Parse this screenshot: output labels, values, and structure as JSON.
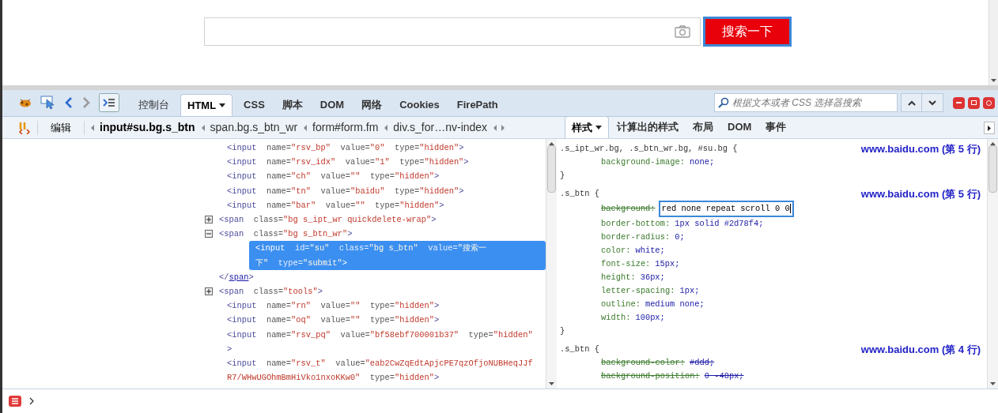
{
  "page": {
    "search_button": "搜索一下"
  },
  "toolbar": {
    "tabs": [
      {
        "label": "控制台",
        "selected": false,
        "dropdown": false
      },
      {
        "label": "HTML",
        "selected": true,
        "dropdown": true
      },
      {
        "label": "CSS",
        "selected": false,
        "dropdown": false
      },
      {
        "label": "脚本",
        "selected": false,
        "dropdown": false
      },
      {
        "label": "DOM",
        "selected": false,
        "dropdown": false
      },
      {
        "label": "网络",
        "selected": false,
        "dropdown": false
      },
      {
        "label": "Cookies",
        "selected": false,
        "dropdown": false
      },
      {
        "label": "FirePath",
        "selected": false,
        "dropdown": false
      }
    ],
    "search": {
      "placeholder": "根据文本或者 CSS 选择器搜索"
    }
  },
  "html_panel": {
    "edit_button": "编辑",
    "breadcrumbs": [
      {
        "label": "input#su.bg.s_btn",
        "selected": true
      },
      {
        "label": "span.bg.s_btn_wr",
        "selected": false
      },
      {
        "label": "form#form.fm",
        "selected": false
      },
      {
        "label": "div.s_for…nv-index",
        "selected": false
      }
    ],
    "nodes": [
      {
        "kind": "leaf",
        "selected": false,
        "lines": [
          [
            {
              "text": "<input",
              "kind": "tag"
            },
            {
              "text": "  name=",
              "kind": "attr"
            },
            {
              "text": "\"rsv_bp\"",
              "kind": "value"
            },
            {
              "text": "  value=",
              "kind": "attr"
            },
            {
              "text": "\"0\"",
              "kind": "value"
            },
            {
              "text": "  type=",
              "kind": "attr"
            },
            {
              "text": "\"hidden\"",
              "kind": "value"
            },
            {
              "text": ">",
              "kind": "tag"
            }
          ]
        ]
      },
      {
        "kind": "leaf",
        "selected": false,
        "lines": [
          [
            {
              "text": "<input",
              "kind": "tag"
            },
            {
              "text": "  name=",
              "kind": "attr"
            },
            {
              "text": "\"rsv_idx\"",
              "kind": "value"
            },
            {
              "text": "  value=",
              "kind": "attr"
            },
            {
              "text": "\"1\"",
              "kind": "value"
            },
            {
              "text": "  type=",
              "kind": "attr"
            },
            {
              "text": "\"hidden\"",
              "kind": "value"
            },
            {
              "text": ">",
              "kind": "tag"
            }
          ]
        ]
      },
      {
        "kind": "leaf",
        "selected": false,
        "lines": [
          [
            {
              "text": "<input",
              "kind": "tag"
            },
            {
              "text": "  name=",
              "kind": "attr"
            },
            {
              "text": "\"ch\"",
              "kind": "value"
            },
            {
              "text": "  value=",
              "kind": "attr"
            },
            {
              "text": "\"\"",
              "kind": "value"
            },
            {
              "text": "  type=",
              "kind": "attr"
            },
            {
              "text": "\"hidden\"",
              "kind": "value"
            },
            {
              "text": ">",
              "kind": "tag"
            }
          ]
        ]
      },
      {
        "kind": "leaf",
        "selected": false,
        "lines": [
          [
            {
              "text": "<input",
              "kind": "tag"
            },
            {
              "text": "  name=",
              "kind": "attr"
            },
            {
              "text": "\"tn\"",
              "kind": "value"
            },
            {
              "text": "  value=",
              "kind": "attr"
            },
            {
              "text": "\"baidu\"",
              "kind": "value"
            },
            {
              "text": "  type=",
              "kind": "attr"
            },
            {
              "text": "\"hidden\"",
              "kind": "value"
            },
            {
              "text": ">",
              "kind": "tag"
            }
          ]
        ]
      },
      {
        "kind": "leaf",
        "selected": false,
        "lines": [
          [
            {
              "text": "<input",
              "kind": "tag"
            },
            {
              "text": "  name=",
              "kind": "attr"
            },
            {
              "text": "\"bar\"",
              "kind": "value"
            },
            {
              "text": "  value=",
              "kind": "attr"
            },
            {
              "text": "\"\"",
              "kind": "value"
            },
            {
              "text": "  type=",
              "kind": "attr"
            },
            {
              "text": "\"hidden\"",
              "kind": "value"
            },
            {
              "text": ">",
              "kind": "tag"
            }
          ]
        ]
      },
      {
        "kind": "toggle",
        "expanded": false,
        "selected": false,
        "lines": [
          [
            {
              "text": "<span",
              "kind": "tag"
            },
            {
              "text": "  class=",
              "kind": "attr"
            },
            {
              "text": "\"bg s_ipt_wr quickdelete-wrap\"",
              "kind": "value"
            },
            {
              "text": ">",
              "kind": "tag"
            }
          ]
        ]
      },
      {
        "kind": "toggle",
        "expanded": true,
        "selected": false,
        "lines": [
          [
            {
              "text": "<span",
              "kind": "tag"
            },
            {
              "text": "  class=",
              "kind": "attr"
            },
            {
              "text": "\"bg s_btn_wr\"",
              "kind": "value"
            },
            {
              "text": ">",
              "kind": "tag"
            }
          ]
        ],
        "children": [
          {
            "kind": "leaf",
            "selected": true,
            "lines": [
              [
                {
                  "text": "<input",
                  "kind": "tag"
                },
                {
                  "text": "  id=",
                  "kind": "attr"
                },
                {
                  "text": "\"su\"",
                  "kind": "value"
                },
                {
                  "text": "  class=",
                  "kind": "attr"
                },
                {
                  "text": "\"bg s_btn\"",
                  "kind": "value"
                },
                {
                  "text": "  value=",
                  "kind": "attr"
                },
                {
                  "text": "\"搜索一",
                  "kind": "value"
                }
              ],
              [
                {
                  "text": "下\"",
                  "kind": "value"
                },
                {
                  "text": "  type=",
                  "kind": "attr"
                },
                {
                  "text": "\"submit\"",
                  "kind": "value"
                },
                {
                  "text": ">",
                  "kind": "tag"
                }
              ]
            ]
          }
        ]
      },
      {
        "kind": "close",
        "selected": false,
        "lines": [
          [
            {
              "text": "</",
              "kind": "tag"
            },
            {
              "text": "span",
              "kind": "name"
            },
            {
              "text": ">",
              "kind": "tag"
            }
          ]
        ]
      },
      {
        "kind": "toggle",
        "expanded": false,
        "selected": false,
        "lines": [
          [
            {
              "text": "<span",
              "kind": "tag"
            },
            {
              "text": "  class=",
              "kind": "attr"
            },
            {
              "text": "\"tools\"",
              "kind": "value"
            },
            {
              "text": ">",
              "kind": "tag"
            }
          ]
        ]
      },
      {
        "kind": "leaf",
        "selected": false,
        "lines": [
          [
            {
              "text": "<input",
              "kind": "tag"
            },
            {
              "text": "  name=",
              "kind": "attr"
            },
            {
              "text": "\"rn\"",
              "kind": "value"
            },
            {
              "text": "  value=",
              "kind": "attr"
            },
            {
              "text": "\"\"",
              "kind": "value"
            },
            {
              "text": "  type=",
              "kind": "attr"
            },
            {
              "text": "\"hidden\"",
              "kind": "value"
            },
            {
              "text": ">",
              "kind": "tag"
            }
          ]
        ]
      },
      {
        "kind": "leaf",
        "selected": false,
        "lines": [
          [
            {
              "text": "<input",
              "kind": "tag"
            },
            {
              "text": "  name=",
              "kind": "attr"
            },
            {
              "text": "\"oq\"",
              "kind": "value"
            },
            {
              "text": "  value=",
              "kind": "attr"
            },
            {
              "text": "\"\"",
              "kind": "value"
            },
            {
              "text": "  type=",
              "kind": "attr"
            },
            {
              "text": "\"hidden\"",
              "kind": "value"
            },
            {
              "text": ">",
              "kind": "tag"
            }
          ]
        ]
      },
      {
        "kind": "leaf",
        "selected": false,
        "lines": [
          [
            {
              "text": "<input",
              "kind": "tag"
            },
            {
              "text": "  name=",
              "kind": "attr"
            },
            {
              "text": "\"rsv_pq\"",
              "kind": "value"
            },
            {
              "text": "  value=",
              "kind": "attr"
            },
            {
              "text": "\"bf58ebf700001b37\"",
              "kind": "value"
            },
            {
              "text": "  type=",
              "kind": "attr"
            },
            {
              "text": "\"hidden\"",
              "kind": "value"
            }
          ],
          [
            {
              "text": ">",
              "kind": "tag"
            }
          ]
        ]
      },
      {
        "kind": "leaf",
        "selected": false,
        "lines": [
          [
            {
              "text": "<input",
              "kind": "tag"
            },
            {
              "text": "  name=",
              "kind": "attr"
            },
            {
              "text": "\"rsv_t\"",
              "kind": "value"
            },
            {
              "text": "  value=",
              "kind": "attr"
            },
            {
              "text": "\"eab2CwZqEdtApjcPE7qzOfjoNUBHeqJJf",
              "kind": "value"
            }
          ],
          [
            {
              "text": "R7/WHwUGOhmBmHiVko1nxoKKw0\"",
              "kind": "value"
            },
            {
              "text": "  type=",
              "kind": "attr"
            },
            {
              "text": "\"hidden\"",
              "kind": "value"
            },
            {
              "text": ">",
              "kind": "tag"
            }
          ]
        ]
      }
    ]
  },
  "css_panel": {
    "tabs": [
      {
        "label": "样式",
        "selected": true,
        "dropdown": true
      },
      {
        "label": "计算出的样式",
        "selected": false,
        "dropdown": false
      },
      {
        "label": "布局",
        "selected": false,
        "dropdown": false
      },
      {
        "label": "DOM",
        "selected": false,
        "dropdown": false
      },
      {
        "label": "事件",
        "selected": false,
        "dropdown": false
      }
    ],
    "rules": [
      {
        "selector": ".s_ipt_wr.bg, .s_btn_wr.bg, #su.bg {",
        "source": "www.baidu.com (第 5 行)",
        "close": "}",
        "declarations": [
          {
            "property": "background-image:",
            "value": "none;",
            "overridden": false,
            "editing": false
          }
        ]
      },
      {
        "selector": ".s_btn {",
        "source": "www.baidu.com (第 5 行)",
        "close": "}",
        "declarations": [
          {
            "property": "background:",
            "value": "red none repeat scroll 0 0",
            "overridden": true,
            "editing": true
          },
          {
            "property": "border-bottom:",
            "value": "1px solid #2d78f4;",
            "overridden": false,
            "editing": false
          },
          {
            "property": "border-radius:",
            "value": "0;",
            "overridden": false,
            "editing": false
          },
          {
            "property": "color:",
            "value": "white;",
            "overridden": false,
            "editing": false
          },
          {
            "property": "font-size:",
            "value": "15px;",
            "overridden": false,
            "editing": false
          },
          {
            "property": "height:",
            "value": "36px;",
            "overridden": false,
            "editing": false
          },
          {
            "property": "letter-spacing:",
            "value": "1px;",
            "overridden": false,
            "editing": false
          },
          {
            "property": "outline:",
            "value": "medium none;",
            "overridden": false,
            "editing": false
          },
          {
            "property": "width:",
            "value": "100px;",
            "overridden": false,
            "editing": false
          }
        ]
      },
      {
        "selector": ".s_btn {",
        "source": "www.baidu.com (第 4 行)",
        "declarations": [
          {
            "property": "background-color:",
            "value": "#ddd;",
            "overridden": true,
            "editing": false
          },
          {
            "property": "background-position:",
            "value": "0 -48px;",
            "overridden": true,
            "editing": false
          }
        ]
      }
    ]
  }
}
